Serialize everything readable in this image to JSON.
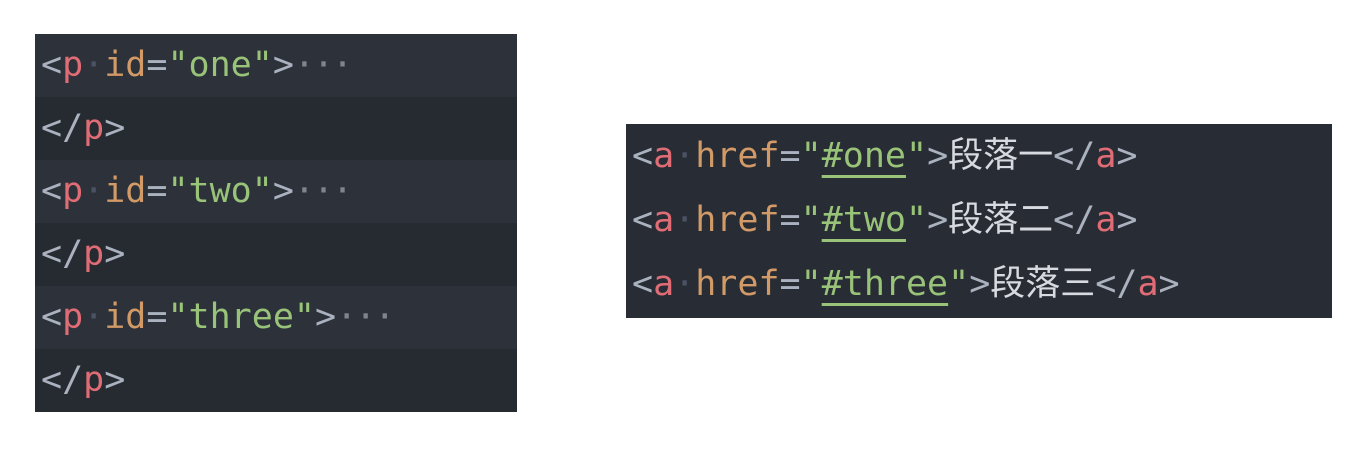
{
  "left_code": {
    "lines": [
      {
        "open": "<",
        "tag": "p",
        "space": "·",
        "attr": "id",
        "eq": "=",
        "value": "\"one\"",
        "close": ">",
        "ellipsis": "···"
      },
      {
        "open": "</",
        "tag": "p",
        "close": ">"
      },
      {
        "open": "<",
        "tag": "p",
        "space": "·",
        "attr": "id",
        "eq": "=",
        "value": "\"two\"",
        "close": ">",
        "ellipsis": "···"
      },
      {
        "open": "</",
        "tag": "p",
        "close": ">"
      },
      {
        "open": "<",
        "tag": "p",
        "space": "·",
        "attr": "id",
        "eq": "=",
        "value": "\"three\"",
        "close": ">",
        "ellipsis": "···"
      },
      {
        "open": "</",
        "tag": "p",
        "close": ">"
      }
    ]
  },
  "right_code": {
    "lines": [
      {
        "open": "<",
        "tag": "a",
        "space": "·",
        "attr": "href",
        "eq": "=",
        "q1": "\"",
        "href": "#one",
        "q2": "\"",
        "close": ">",
        "text": "段落一",
        "end_open": "</",
        "end_tag": "a",
        "end_close": ">"
      },
      {
        "open": "<",
        "tag": "a",
        "space": "·",
        "attr": "href",
        "eq": "=",
        "q1": "\"",
        "href": "#two",
        "q2": "\"",
        "close": ">",
        "text": "段落二",
        "end_open": "</",
        "end_tag": "a",
        "end_close": ">"
      },
      {
        "open": "<",
        "tag": "a",
        "space": "·",
        "attr": "href",
        "eq": "=",
        "q1": "\"",
        "href": "#three",
        "q2": "\"",
        "close": ">",
        "text": "段落三",
        "end_open": "</",
        "end_tag": "a",
        "end_close": ">"
      }
    ]
  },
  "colors": {
    "background": "#282c34",
    "tag": "#e06c75",
    "attribute": "#d19a66",
    "string": "#98c379",
    "punctuation": "#abb2bf"
  }
}
